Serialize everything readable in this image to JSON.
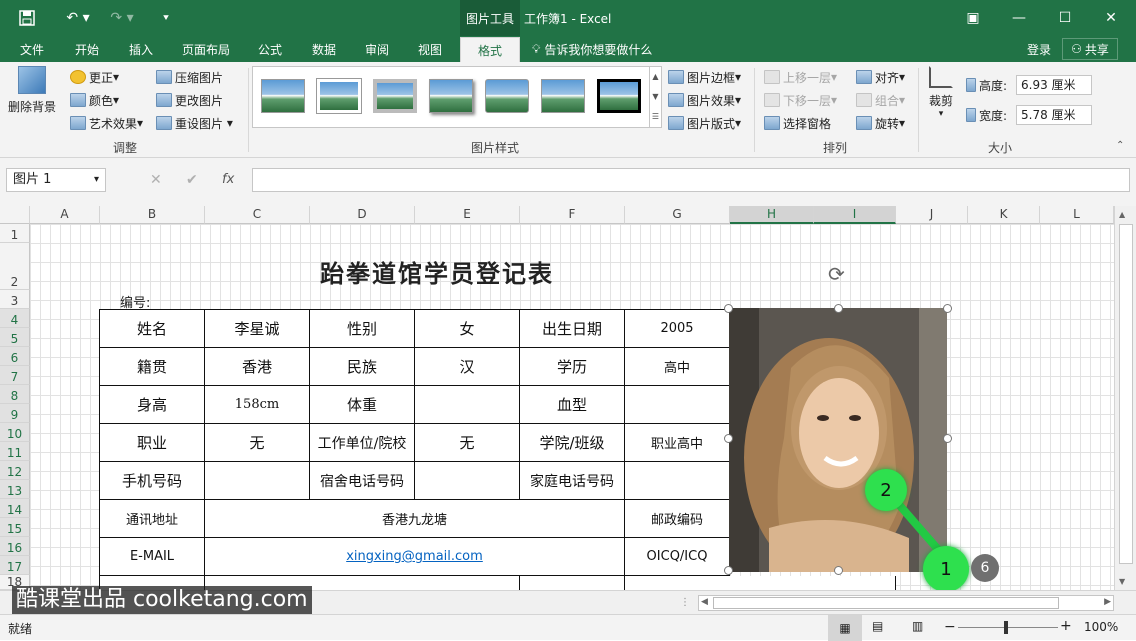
{
  "titlebar": {
    "save_icon": "save-icon",
    "undo_icon": "undo-icon",
    "redo_icon": "redo-icon",
    "customize_icon": "customize-qat-icon",
    "context_tab": "图片工具",
    "title": "工作簿1 - Excel",
    "ribbon_options_icon": "ribbon-display-options-icon",
    "minimize": "—",
    "restore": "☐",
    "close": "✕"
  },
  "tabs": [
    "文件",
    "开始",
    "插入",
    "页面布局",
    "公式",
    "数据",
    "审阅",
    "视图",
    "格式"
  ],
  "tell_me": "告诉我你想要做什么",
  "account": {
    "login": "登录",
    "share": "共享"
  },
  "ribbon": {
    "adjust": {
      "remove_bg": "删除背景",
      "correct": "更正",
      "color": "颜色",
      "artistic": "艺术效果",
      "compress": "压缩图片",
      "change": "更改图片",
      "reset": "重设图片",
      "label": "调整"
    },
    "styles": {
      "label": "图片样式",
      "border": "图片边框",
      "effects": "图片效果",
      "layout": "图片版式"
    },
    "arrange": {
      "label": "排列",
      "bring_forward": "上移一层",
      "send_backward": "下移一层",
      "selection_pane": "选择窗格",
      "align": "对齐",
      "group": "组合",
      "rotate": "旋转"
    },
    "size": {
      "label": "大小",
      "crop": "裁剪",
      "height_label": "高度:",
      "height": "6.93 厘米",
      "width_label": "宽度:",
      "width": "5.78 厘米"
    }
  },
  "formula": {
    "name_box": "图片 1",
    "fx": "fx",
    "cancel": "✕",
    "enter": "✔"
  },
  "columns": [
    "A",
    "B",
    "C",
    "D",
    "E",
    "F",
    "G",
    "H",
    "I",
    "J",
    "K",
    "L"
  ],
  "rows": [
    "1",
    "2",
    "3",
    "4",
    "5",
    "6",
    "7",
    "8",
    "9",
    "10",
    "11",
    "12",
    "13",
    "14",
    "15",
    "16",
    "17",
    "18"
  ],
  "sheet": {
    "title": "跆拳道馆学员登记表",
    "number_label": "编号:",
    "table": [
      [
        "姓名",
        "李星诚",
        "性别",
        "女",
        "出生日期",
        "2005"
      ],
      [
        "籍贯",
        "香港",
        "民族",
        "汉",
        "学历",
        "高中"
      ],
      [
        "身高",
        "158cm",
        "体重",
        "",
        "血型",
        ""
      ],
      [
        "职业",
        "无",
        "工作单位/院校",
        "无",
        "学院/班级",
        "职业高中"
      ],
      [
        "手机号码",
        "",
        "宿舍电话号码",
        "",
        "家庭电话号码",
        ""
      ],
      [
        "通讯地址",
        "香港九龙塘",
        "邮政编码"
      ],
      [
        "E-MAIL",
        "xingxing@gmail.com",
        "OICQ/ICQ"
      ]
    ]
  },
  "annotations": {
    "step1": "1",
    "step2": "2",
    "badge": "6"
  },
  "watermark": "酷课堂出品 coolketang.com",
  "status": {
    "ready": "就绪",
    "zoom": "100%",
    "minus": "−",
    "plus": "+"
  },
  "colors": {
    "excel_green": "#217346",
    "annotation_green": "#2ee04e"
  }
}
